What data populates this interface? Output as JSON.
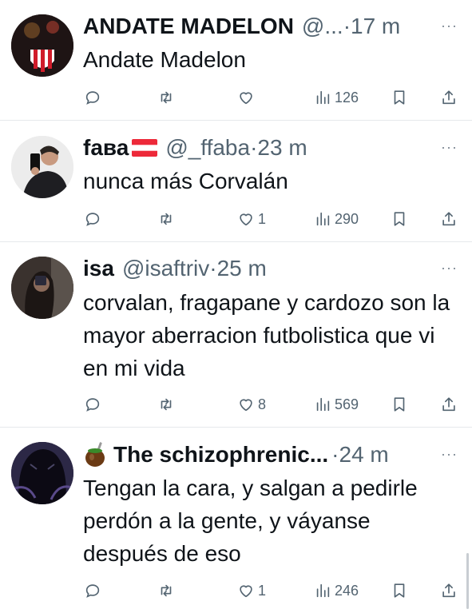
{
  "tweets": [
    {
      "display_name": "ANDATE MADELON",
      "handle": "@...",
      "time": "·17 m",
      "text": "Andate Madelon",
      "more": "···",
      "replies": "",
      "retweets": "",
      "likes": "",
      "views": "126"
    },
    {
      "display_name": "fава",
      "handle": "@_ffaba",
      "time": "·23 m",
      "text": "nunca más Corvalán",
      "more": "···",
      "replies": "",
      "retweets": "",
      "likes": "1",
      "views": "290"
    },
    {
      "display_name": "isa",
      "handle": "@isaftriv",
      "time": "·25 m",
      "text": "corvalan, fragapane y cardozo son la mayor aberracion futbolistica que vi en mi vida",
      "more": "···",
      "replies": "",
      "retweets": "",
      "likes": "8",
      "views": "569"
    },
    {
      "display_name": "The schizophrenic...",
      "handle": "",
      "time": "·24 m",
      "text": "Tengan la cara, y salgan a pedirle perdón a la gente, y váyanse después de eso",
      "more": "···",
      "replies": "",
      "retweets": "",
      "likes": "1",
      "views": "246"
    }
  ],
  "colors": {
    "text": "#0f1419",
    "secondary": "#536471",
    "divider": "#e6e9ec"
  },
  "icons": [
    "reply-icon",
    "retweet-icon",
    "like-icon",
    "views-icon",
    "bookmark-icon",
    "share-icon",
    "more-icon"
  ]
}
